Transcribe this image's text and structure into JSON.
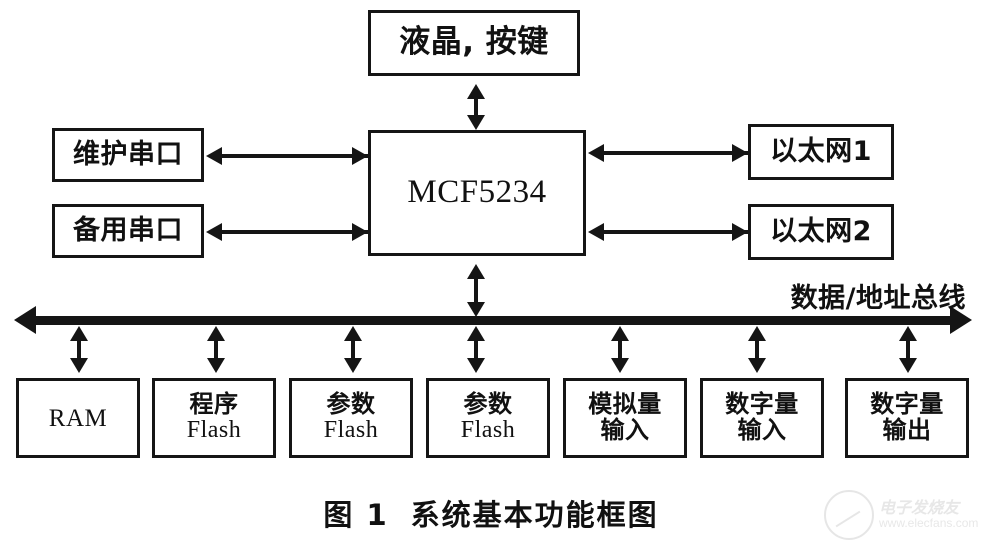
{
  "figure": {
    "caption_number": "图 1",
    "caption_text": "系统基本功能框图"
  },
  "diagram": {
    "type": "block-diagram",
    "controller": {
      "id": "mcu",
      "label": "MCF5234"
    },
    "peripherals": {
      "top": [
        {
          "id": "lcd-keys",
          "label": "液晶, 按键",
          "link": "bidirectional"
        }
      ],
      "left": [
        {
          "id": "serial-maint",
          "label": "维护串口",
          "link": "bidirectional"
        },
        {
          "id": "serial-backup",
          "label": "备用串口",
          "link": "bidirectional"
        }
      ],
      "right": [
        {
          "id": "ethernet-1",
          "label": "以太网1",
          "link": "bidirectional"
        },
        {
          "id": "ethernet-2",
          "label": "以太网2",
          "link": "bidirectional"
        }
      ]
    },
    "bus": {
      "id": "data-address-bus",
      "label": "数据/地址总线",
      "direction": "bidirectional"
    },
    "bus_devices": [
      {
        "id": "ram",
        "line1": "RAM",
        "line2": "",
        "lang": "latin"
      },
      {
        "id": "program-flash",
        "line1": "程序",
        "line2": "Flash",
        "lang": "mixed"
      },
      {
        "id": "param-flash-1",
        "line1": "参数",
        "line2": "Flash",
        "lang": "mixed"
      },
      {
        "id": "param-flash-2",
        "line1": "参数",
        "line2": "Flash",
        "lang": "mixed"
      },
      {
        "id": "analog-input",
        "line1": "模拟量",
        "line2": "输入",
        "lang": "cjk"
      },
      {
        "id": "digital-input",
        "line1": "数字量",
        "line2": "输入",
        "lang": "cjk"
      },
      {
        "id": "digital-output",
        "line1": "数字量",
        "line2": "输出",
        "lang": "cjk"
      }
    ]
  },
  "watermark": {
    "name": "电子发烧友",
    "url": "www.elecfans.com"
  }
}
